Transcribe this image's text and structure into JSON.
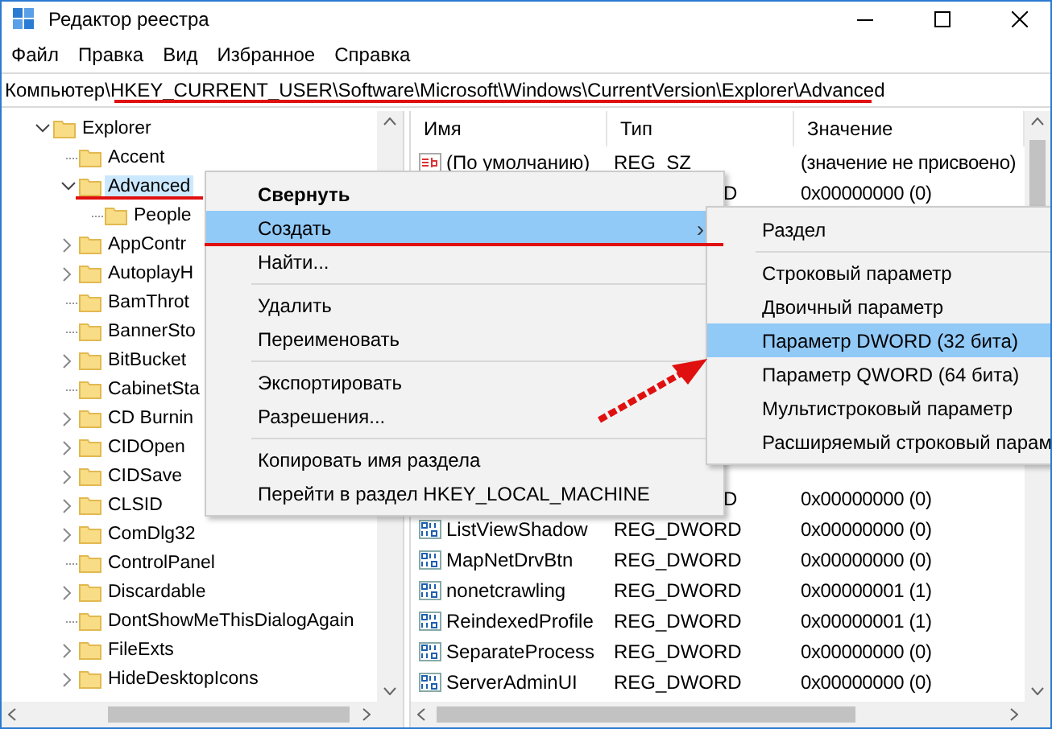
{
  "window": {
    "title": "Редактор реестра"
  },
  "menu_bar": [
    "Файл",
    "Правка",
    "Вид",
    "Избранное",
    "Справка"
  ],
  "address": {
    "path": "Компьютер\\HKEY_CURRENT_USER\\Software\\Microsoft\\Windows\\CurrentVersion\\Explorer\\Advanced"
  },
  "tree": [
    {
      "label": "Explorer",
      "kind": "branch",
      "expanded": true,
      "selected": false,
      "children": [
        {
          "label": "Accent",
          "kind": "leaf",
          "selected": false
        },
        {
          "label": "Advanced",
          "kind": "branch",
          "expanded": true,
          "selected": true,
          "children": [
            {
              "label": "People",
              "kind": "leaf",
              "selected": false
            }
          ]
        },
        {
          "label": "AppContr",
          "kind": "branch",
          "expanded": false,
          "selected": false
        },
        {
          "label": "AutoplayH",
          "kind": "branch",
          "expanded": false,
          "selected": false
        },
        {
          "label": "BamThrot",
          "kind": "leaf",
          "selected": false
        },
        {
          "label": "BannerSto",
          "kind": "leaf",
          "selected": false
        },
        {
          "label": "BitBucket",
          "kind": "branch",
          "expanded": false,
          "selected": false
        },
        {
          "label": "CabinetSta",
          "kind": "leaf",
          "selected": false
        },
        {
          "label": "CD Burnin",
          "kind": "branch",
          "expanded": false,
          "selected": false
        },
        {
          "label": "CIDOpen",
          "kind": "branch",
          "expanded": false,
          "selected": false
        },
        {
          "label": "CIDSave",
          "kind": "branch",
          "expanded": false,
          "selected": false
        },
        {
          "label": "CLSID",
          "kind": "branch",
          "expanded": false,
          "selected": false
        },
        {
          "label": "ComDlg32",
          "kind": "branch",
          "expanded": false,
          "selected": false
        },
        {
          "label": "ControlPanel",
          "kind": "leaf",
          "selected": false
        },
        {
          "label": "Discardable",
          "kind": "branch",
          "expanded": false,
          "selected": false
        },
        {
          "label": "DontShowMeThisDialogAgain",
          "kind": "leaf",
          "selected": false
        },
        {
          "label": "FileExts",
          "kind": "branch",
          "expanded": false,
          "selected": false
        },
        {
          "label": "HideDesktopIcons",
          "kind": "branch",
          "expanded": false,
          "selected": false
        }
      ]
    }
  ],
  "values": {
    "columns": [
      "Имя",
      "Тип",
      "Значение"
    ],
    "rows": [
      {
        "kind": "string",
        "name": "(По умолчанию)",
        "type": "REG_SZ",
        "value": "(значение не присвоено)"
      },
      {
        "kind": "tail",
        "type": "D",
        "value": "0x00000000 (0)"
      },
      {
        "kind": "covered"
      },
      {
        "kind": "covered"
      },
      {
        "kind": "covered"
      },
      {
        "kind": "covered"
      },
      {
        "kind": "covered"
      },
      {
        "kind": "covered"
      },
      {
        "kind": "covered"
      },
      {
        "kind": "covered"
      },
      {
        "kind": "covered"
      },
      {
        "kind": "tail",
        "type": "D",
        "value": "0x00000000 (0)"
      },
      {
        "kind": "dword",
        "name": "ListViewShadow",
        "type": "REG_DWORD",
        "value": "0x00000000 (0)"
      },
      {
        "kind": "dword",
        "name": "MapNetDrvBtn",
        "type": "REG_DWORD",
        "value": "0x00000000 (0)"
      },
      {
        "kind": "dword",
        "name": "nonetcrawling",
        "type": "REG_DWORD",
        "value": "0x00000001 (1)"
      },
      {
        "kind": "dword",
        "name": "ReindexedProfile",
        "type": "REG_DWORD",
        "value": "0x00000001 (1)"
      },
      {
        "kind": "dword",
        "name": "SeparateProcess",
        "type": "REG_DWORD",
        "value": "0x00000000 (0)"
      },
      {
        "kind": "dword",
        "name": "ServerAdminUI",
        "type": "REG_DWORD",
        "value": "0x00000000 (0)"
      }
    ]
  },
  "context_menu": {
    "items": [
      {
        "kind": "item",
        "label": "Свернуть",
        "bold": true,
        "selected": false
      },
      {
        "kind": "item",
        "label": "Создать",
        "bold": false,
        "selected": true,
        "arrow": "›"
      },
      {
        "kind": "item",
        "label": "Найти...",
        "bold": false,
        "selected": false
      },
      {
        "kind": "separator"
      },
      {
        "kind": "item",
        "label": "Удалить",
        "bold": false,
        "selected": false
      },
      {
        "kind": "item",
        "label": "Переименовать",
        "bold": false,
        "selected": false
      },
      {
        "kind": "separator"
      },
      {
        "kind": "item",
        "label": "Экспортировать",
        "bold": false,
        "selected": false
      },
      {
        "kind": "item",
        "label": "Разрешения...",
        "bold": false,
        "selected": false
      },
      {
        "kind": "separator"
      },
      {
        "kind": "item",
        "label": "Копировать имя раздела",
        "bold": false,
        "selected": false
      },
      {
        "kind": "item",
        "label": "Перейти в раздел HKEY_LOCAL_MACHINE",
        "bold": false,
        "selected": false
      }
    ]
  },
  "submenu": {
    "items": [
      {
        "kind": "item",
        "label": "Раздел",
        "selected": false
      },
      {
        "kind": "separator"
      },
      {
        "kind": "item",
        "label": "Строковый параметр",
        "selected": false
      },
      {
        "kind": "item",
        "label": "Двоичный параметр",
        "selected": false
      },
      {
        "kind": "item",
        "label": "Параметр DWORD (32 бита)",
        "selected": true
      },
      {
        "kind": "item",
        "label": "Параметр QWORD (64 бита)",
        "selected": false
      },
      {
        "kind": "item",
        "label": "Мультистроковый параметр",
        "selected": false
      },
      {
        "kind": "item",
        "label": "Расширяемый строковый парам",
        "selected": false
      }
    ]
  },
  "annotations": [
    {
      "kind": "address_underline"
    },
    {
      "kind": "tree_underline"
    },
    {
      "kind": "menu_underline"
    },
    {
      "kind": "arrow"
    }
  ]
}
